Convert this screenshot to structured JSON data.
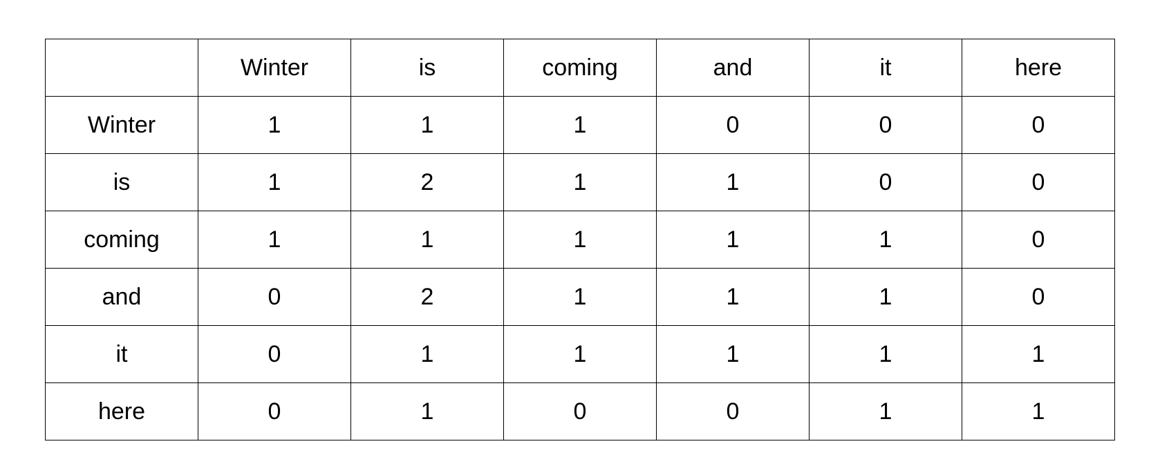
{
  "table": {
    "corner": "",
    "columns": [
      "Winter",
      "is",
      "coming",
      "and",
      "it",
      "here"
    ],
    "rows": [
      {
        "label": "Winter",
        "cells": [
          "1",
          "1",
          "1",
          "0",
          "0",
          "0"
        ]
      },
      {
        "label": "is",
        "cells": [
          "1",
          "2",
          "1",
          "1",
          "0",
          "0"
        ]
      },
      {
        "label": "coming",
        "cells": [
          "1",
          "1",
          "1",
          "1",
          "1",
          "0"
        ]
      },
      {
        "label": "and",
        "cells": [
          "0",
          "2",
          "1",
          "1",
          "1",
          "0"
        ]
      },
      {
        "label": "it",
        "cells": [
          "0",
          "1",
          "1",
          "1",
          "1",
          "1"
        ]
      },
      {
        "label": "here",
        "cells": [
          "0",
          "1",
          "0",
          "0",
          "1",
          "1"
        ]
      }
    ]
  }
}
